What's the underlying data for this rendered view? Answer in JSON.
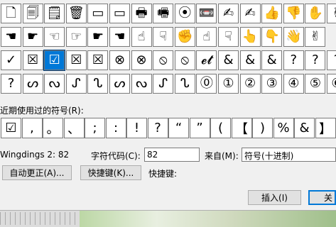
{
  "symbol_grid": {
    "rows": [
      [
        "🗋",
        "🗐",
        "🗒",
        "🗑",
        "▭",
        "▭",
        "🖶",
        "🖷",
        "⦿",
        "📼",
        "✍",
        "✍",
        "👍",
        "👎",
        "✋",
        "✌"
      ],
      [
        "☚",
        "☛",
        "☜",
        "☞",
        "☛",
        "☚",
        "☝",
        "☟",
        "✊",
        "☝",
        "☟",
        "👆",
        "👇",
        "👋",
        "✌"
      ],
      [
        "✓",
        "☒",
        "☑",
        "☒",
        "☒",
        "⊗",
        "⊗",
        "⦸",
        "⦸",
        "𝓮𝓽",
        "&",
        "&",
        "&",
        "?",
        "?",
        "?"
      ],
      [
        "?",
        "ᔕ",
        "ᔓ",
        "ᔑ",
        "ᔐ",
        "ᔕ",
        "ᔓ",
        "ᔑ",
        "ᔐ",
        "⓪",
        "①",
        "②",
        "③",
        "④",
        "⑤",
        "⑥"
      ]
    ],
    "selected": {
      "row": 2,
      "col": 2
    }
  },
  "recent": {
    "label": "近期使用过的符号(R):",
    "symbols": [
      "☑",
      ",",
      "。",
      "、",
      ";",
      ":",
      "!",
      "?",
      "“",
      "”",
      "(",
      "【",
      ")",
      "%",
      "&",
      "】"
    ]
  },
  "info": {
    "font_name": "Wingdings 2: 82",
    "char_code_label": "字符代码(C):",
    "char_code_value": "82",
    "from_label": "来自(M):",
    "from_value": "符号(十进制)"
  },
  "buttons": {
    "autocorrect": "自动更正(A)...",
    "shortcut_key": "快捷键(K)...",
    "shortcut_label": "快捷键:",
    "insert": "插入(I)",
    "close": "关"
  }
}
